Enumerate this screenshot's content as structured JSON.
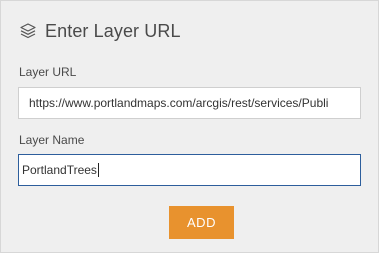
{
  "header": {
    "icon": "layers-icon",
    "title": "Enter Layer URL"
  },
  "form": {
    "url_label": "Layer URL",
    "url_value": "https://www.portlandmaps.com/arcgis/rest/services/Publi",
    "name_label": "Layer Name",
    "name_value": "PortlandTrees"
  },
  "actions": {
    "add_label": "ADD"
  },
  "colors": {
    "panel_background": "#efefef",
    "accent_button": "#e8922e",
    "focus_border": "#2d5e9c"
  }
}
